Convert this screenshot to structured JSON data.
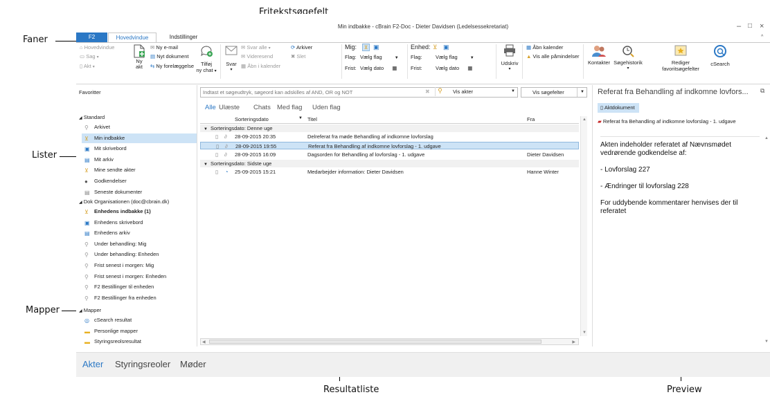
{
  "callouts": {
    "faner": "Faner",
    "lister": "Lister",
    "mapper": "Mapper",
    "fritekst": "Fritekstsøgefelt",
    "resultatliste": "Resultatliste",
    "preview": "Preview"
  },
  "window": {
    "title": "Min indbakke - cBrain F2-Doc - Dieter Davidsen (Ledelsessekretariat)",
    "minimize": "–",
    "maximize": "□",
    "close": "×",
    "collapse": "^"
  },
  "tabs": [
    "F2",
    "Hovedvindue",
    "Indstillinger"
  ],
  "ribbon": {
    "hovedvindue": "Hovedvindue",
    "sag": "Sag",
    "akt": "Akt",
    "ny_akt_1": "Ny",
    "ny_akt_2": "akt",
    "ny_email": "Ny e-mail",
    "nyt_dokument": "Nyt dokument",
    "ny_forelaeggelse": "Ny forelæggelse",
    "tilfoej_1": "Tilføj",
    "tilfoej_2": "ny chat",
    "svar": "Svar",
    "svar_alle": "Svar alle",
    "videresend": "Videresend",
    "aabn_i_kalender": "Åbn i kalender",
    "arkiver": "Arkiver",
    "slet": "Slet",
    "mig": "Mig:",
    "flag_label": "Flag:",
    "frist_label": "Frist:",
    "vaelg_flag": "Vælg flag",
    "vaelg_dato": "Vælg dato",
    "enhed": "Enhed:",
    "udskriv": "Udskriv",
    "aabn_kalender": "Åbn kalender",
    "vis_alle_paamindelser": "Vis alle påmindelser",
    "kontakter": "Kontakter",
    "soegehistorik": "Søgehistorik",
    "rediger_1": "Rediger",
    "rediger_2": "favoritsøgefelter",
    "csearch": "cSearch"
  },
  "left_pane": {
    "favoritter": "Favoritter",
    "standard_header": "Standard",
    "standard": [
      "Arkivet",
      "Min indbakke",
      "Mit skrivebord",
      "Mit arkiv",
      "Mine sendte akter",
      "Godkendelser",
      "Seneste dokumenter"
    ],
    "org_header": "Dok Organisationen (doc@cbrain.dk)",
    "org": [
      "Enhedens indbakke (1)",
      "Enhedens skrivebord",
      "Enhedens arkiv",
      "Under behandling: Mig",
      "Under behandling: Enheden",
      "Frist senest i morgen: Mig",
      "Frist senest i morgen: Enheden",
      "F2 Bestillinger til enheden",
      "F2 Bestillinger fra enheden"
    ],
    "mapper_header": "Mapper",
    "mapper": [
      "cSearch resultat",
      "Personlige mapper",
      "Styringsreolsresultat"
    ]
  },
  "search": {
    "placeholder": "Indtast et søgeudtryk, søgeord kan adskilles af AND, OR og NOT",
    "vis_akter": "Vis akter",
    "vis_soegefelter": "Vis søgefelter"
  },
  "filter_tabs": [
    "Alle",
    "Ulæste",
    "Chats",
    "Med flag",
    "Uden flag"
  ],
  "result_list": {
    "col_date": "Sorteringsdato",
    "col_title": "Titel",
    "col_from": "Fra",
    "groups": [
      {
        "label": "Sorteringsdato: Denne uge",
        "rows": [
          {
            "date": "28-09-2015 20:35",
            "title": "Delreferat fra møde Behandling af indkomne lovforslag",
            "from": ""
          },
          {
            "date": "28-09-2015 19:55",
            "title": "Referat fra Behandling af indkomne lovforslag - 1. udgave",
            "from": ""
          },
          {
            "date": "28-09-2015 16:09",
            "title": "Dagsorden for Behandling af lovforslag - 1. udgave",
            "from": "Dieter Davidsen"
          }
        ]
      },
      {
        "label": "Sorteringsdato: Sidste uge",
        "rows": [
          {
            "date": "25-09-2015 15:21",
            "title": "Medarbejder information: Dieter Davidsen",
            "from": "Hanne Winter"
          }
        ]
      }
    ]
  },
  "preview": {
    "title": "Referat fra Behandling af indkomne lovfors...",
    "tab": "Aktdokument",
    "file": "Referat fra Behandling af indkomne lovforslag - 1. udgave",
    "body": [
      "Akten indeholder referatet af Nævnsmødet vedrørende godkendelse af:",
      "- Lovforslag 227",
      "- Ændringer til lovforslag 228",
      "For uddybende kommentarer henvises der til referatet"
    ]
  },
  "bottom_nav": [
    "Akter",
    "Styringsreoler",
    "Møder"
  ],
  "colors": {
    "accent": "#2b78c5",
    "selection": "#cde3f6"
  }
}
